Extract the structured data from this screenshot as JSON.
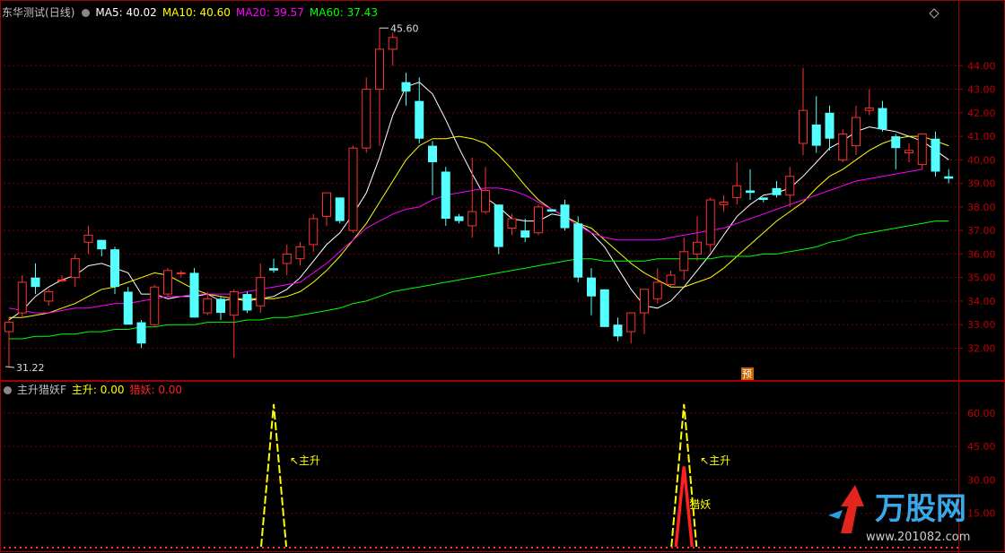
{
  "header": {
    "stock_name": "东华测试",
    "period": "(日线)",
    "ma": [
      {
        "label": "MA5:",
        "value": "40.02",
        "color": "#ffffff"
      },
      {
        "label": "MA10:",
        "value": "40.60",
        "color": "#ffff00"
      },
      {
        "label": "MA20:",
        "value": "39.57",
        "color": "#ff00ff"
      },
      {
        "label": "MA60:",
        "value": "37.43",
        "color": "#00ff00"
      }
    ]
  },
  "sub_header": {
    "indicator": "主升猎妖F",
    "items": [
      {
        "label": "主升:",
        "value": "0.00",
        "color": "#ffff00"
      },
      {
        "label": "猎妖:",
        "value": "0.00",
        "color": "#ff2020"
      }
    ]
  },
  "watermark": {
    "brand": "万股网",
    "url": "www.201082.com"
  },
  "chart_data": [
    {
      "type": "candlestick",
      "ylim": [
        30.8,
        45.8
      ],
      "yticks": [
        "32.00",
        "33.00",
        "34.00",
        "35.00",
        "36.00",
        "37.00",
        "38.00",
        "39.00",
        "40.00",
        "41.00",
        "42.00",
        "43.00",
        "44.00"
      ],
      "annotations": {
        "high": "45.60",
        "low": "31.22",
        "forecast_marker": "预"
      },
      "candles": [
        [
          32.7,
          33.3,
          31.2,
          33.1
        ],
        [
          33.5,
          35.1,
          33.3,
          34.8
        ],
        [
          35.0,
          35.6,
          34.3,
          34.6
        ],
        [
          34.0,
          34.5,
          33.8,
          34.4
        ],
        [
          34.9,
          35.1,
          34.8,
          34.9
        ],
        [
          35.0,
          36.0,
          34.6,
          35.8
        ],
        [
          36.5,
          37.2,
          36.0,
          36.8
        ],
        [
          36.6,
          36.6,
          35.9,
          36.2
        ],
        [
          36.2,
          36.3,
          34.3,
          34.6
        ],
        [
          34.4,
          34.6,
          33.0,
          33.0
        ],
        [
          33.1,
          33.2,
          32.0,
          32.2
        ],
        [
          33.0,
          34.7,
          32.9,
          34.6
        ],
        [
          34.3,
          35.4,
          34.2,
          35.3
        ],
        [
          35.2,
          35.3,
          35.0,
          35.2
        ],
        [
          35.2,
          35.4,
          33.9,
          33.3
        ],
        [
          33.5,
          34.4,
          33.4,
          34.1
        ],
        [
          34.1,
          34.2,
          33.2,
          33.5
        ],
        [
          33.4,
          34.5,
          31.6,
          34.4
        ],
        [
          34.3,
          34.4,
          33.5,
          33.6
        ],
        [
          33.8,
          35.6,
          33.5,
          35.0
        ],
        [
          35.4,
          35.8,
          35.2,
          35.3
        ],
        [
          35.6,
          36.4,
          35.1,
          36.0
        ],
        [
          35.8,
          36.5,
          35.5,
          36.3
        ],
        [
          36.4,
          37.7,
          36.1,
          37.5
        ],
        [
          37.6,
          38.6,
          37.2,
          38.6
        ],
        [
          38.4,
          38.4,
          37.3,
          37.4
        ],
        [
          37.0,
          40.6,
          36.9,
          40.5
        ],
        [
          40.5,
          43.5,
          40.3,
          43.0
        ],
        [
          43.0,
          45.6,
          40.6,
          44.7
        ],
        [
          44.7,
          45.4,
          44.0,
          45.2
        ],
        [
          43.3,
          43.7,
          42.3,
          42.9
        ],
        [
          42.5,
          43.5,
          40.7,
          40.9
        ],
        [
          40.6,
          40.8,
          38.5,
          39.9
        ],
        [
          39.5,
          39.7,
          37.2,
          37.5
        ],
        [
          37.6,
          37.7,
          37.3,
          37.4
        ],
        [
          37.2,
          40.1,
          36.7,
          37.8
        ],
        [
          37.8,
          39.7,
          37.7,
          38.7
        ],
        [
          38.1,
          38.1,
          36.0,
          36.3
        ],
        [
          37.1,
          37.7,
          36.8,
          37.5
        ],
        [
          37.0,
          37.5,
          36.5,
          36.7
        ],
        [
          36.9,
          38.1,
          36.8,
          38.0
        ],
        [
          37.9,
          37.9,
          37.8,
          37.8
        ],
        [
          38.1,
          38.3,
          37.0,
          37.1
        ],
        [
          37.3,
          37.6,
          34.8,
          35.0
        ],
        [
          35.0,
          35.4,
          33.4,
          34.2
        ],
        [
          34.5,
          34.5,
          32.9,
          32.9
        ],
        [
          33.0,
          33.3,
          32.3,
          32.5
        ],
        [
          32.7,
          33.5,
          32.2,
          33.5
        ],
        [
          33.5,
          34.5,
          32.6,
          34.5
        ],
        [
          34.1,
          35.4,
          33.9,
          34.8
        ],
        [
          34.7,
          35.3,
          34.6,
          35.1
        ],
        [
          35.3,
          36.7,
          34.9,
          36.1
        ],
        [
          36.0,
          37.6,
          35.7,
          36.5
        ],
        [
          36.4,
          38.4,
          36.1,
          38.3
        ],
        [
          38.1,
          38.5,
          37.8,
          38.2
        ],
        [
          38.4,
          39.9,
          38.1,
          38.9
        ],
        [
          38.7,
          39.6,
          38.3,
          38.6
        ],
        [
          38.4,
          38.4,
          38.2,
          38.3
        ],
        [
          38.8,
          39.1,
          38.4,
          38.5
        ],
        [
          38.5,
          39.7,
          38.0,
          39.3
        ],
        [
          40.7,
          43.9,
          40.2,
          42.1
        ],
        [
          41.5,
          42.7,
          40.3,
          40.6
        ],
        [
          42.0,
          42.3,
          40.4,
          40.9
        ],
        [
          40.0,
          41.3,
          39.9,
          41.1
        ],
        [
          40.6,
          42.3,
          40.2,
          41.8
        ],
        [
          42.1,
          43.0,
          41.9,
          42.2
        ],
        [
          42.2,
          42.5,
          41.2,
          41.3
        ],
        [
          41.0,
          41.1,
          39.6,
          40.5
        ],
        [
          40.3,
          40.7,
          39.9,
          40.4
        ],
        [
          39.8,
          41.1,
          39.6,
          41.1
        ],
        [
          40.9,
          41.2,
          39.3,
          39.5
        ],
        [
          39.3,
          39.6,
          39.0,
          39.2
        ]
      ],
      "series": [
        {
          "name": "MA5",
          "color": "#ffffff",
          "values": [
            33.2,
            33.6,
            34.2,
            34.6,
            34.9,
            35.1,
            35.5,
            35.6,
            35.4,
            35.2,
            34.3,
            34.3,
            34.1,
            34.2,
            34.2,
            34.3,
            34.0,
            34.1,
            34.0,
            34.1,
            34.2,
            34.5,
            35.0,
            35.7,
            36.4,
            36.9,
            37.7,
            38.6,
            40.1,
            41.9,
            43.1,
            43.3,
            42.8,
            41.7,
            40.5,
            39.4,
            38.4,
            38.0,
            37.5,
            37.4,
            37.4,
            37.7,
            37.6,
            37.3,
            36.9,
            36.3,
            35.4,
            34.5,
            33.8,
            33.7,
            34.0,
            34.6,
            35.3,
            36.0,
            36.8,
            37.6,
            38.1,
            38.5,
            38.6,
            38.8,
            39.3,
            39.9,
            40.5,
            40.8,
            41.2,
            41.4,
            41.3,
            41.2,
            41.0,
            40.8,
            40.4,
            40.0
          ]
        },
        {
          "name": "MA10",
          "color": "#ffff00",
          "values": [
            33.3,
            33.3,
            33.4,
            33.5,
            33.7,
            33.9,
            34.2,
            34.5,
            34.6,
            34.8,
            35.0,
            35.2,
            35.1,
            34.8,
            34.5,
            34.3,
            34.2,
            34.1,
            34.1,
            34.1,
            34.1,
            34.2,
            34.4,
            34.8,
            35.3,
            35.9,
            36.6,
            37.3,
            38.2,
            39.1,
            40.0,
            40.6,
            40.9,
            40.9,
            41.0,
            40.9,
            40.7,
            40.2,
            39.6,
            38.9,
            38.3,
            37.9,
            37.6,
            37.3,
            37.1,
            36.6,
            36.1,
            35.6,
            35.2,
            34.9,
            34.6,
            34.6,
            34.8,
            35.0,
            35.4,
            35.9,
            36.4,
            36.9,
            37.4,
            37.8,
            38.2,
            38.8,
            39.3,
            39.6,
            40.0,
            40.4,
            40.7,
            40.9,
            41.0,
            41.0,
            40.8,
            40.6
          ]
        },
        {
          "name": "MA20",
          "color": "#ff00ff",
          "values": [
            33.7,
            33.6,
            33.5,
            33.5,
            33.6,
            33.7,
            33.7,
            33.8,
            33.9,
            33.9,
            34.0,
            34.1,
            34.2,
            34.2,
            34.3,
            34.3,
            34.3,
            34.3,
            34.4,
            34.5,
            34.6,
            34.7,
            34.8,
            35.2,
            35.6,
            36.1,
            36.6,
            37.1,
            37.4,
            37.7,
            37.9,
            38.0,
            38.3,
            38.5,
            38.6,
            38.7,
            38.8,
            38.8,
            38.7,
            38.5,
            38.2,
            37.9,
            37.6,
            37.2,
            36.9,
            36.7,
            36.6,
            36.6,
            36.6,
            36.6,
            36.7,
            36.8,
            36.9,
            37.0,
            37.1,
            37.3,
            37.5,
            37.7,
            37.9,
            38.1,
            38.3,
            38.5,
            38.7,
            38.9,
            39.1,
            39.2,
            39.3,
            39.4,
            39.5,
            39.6
          ]
        },
        {
          "name": "MA60",
          "color": "#00ff00",
          "values": [
            32.4,
            32.4,
            32.5,
            32.5,
            32.6,
            32.6,
            32.7,
            32.7,
            32.8,
            32.8,
            32.9,
            32.9,
            33.0,
            33.0,
            33.0,
            33.1,
            33.1,
            33.1,
            33.2,
            33.2,
            33.3,
            33.3,
            33.4,
            33.5,
            33.6,
            33.7,
            33.9,
            34.0,
            34.2,
            34.4,
            34.5,
            34.6,
            34.7,
            34.8,
            34.9,
            35.0,
            35.1,
            35.2,
            35.3,
            35.4,
            35.5,
            35.6,
            35.7,
            35.8,
            35.8,
            35.7,
            35.7,
            35.7,
            35.7,
            35.8,
            35.8,
            35.8,
            35.8,
            35.8,
            35.9,
            35.9,
            35.9,
            36.0,
            36.0,
            36.1,
            36.2,
            36.3,
            36.5,
            36.6,
            36.8,
            36.9,
            37.0,
            37.1,
            37.2,
            37.3,
            37.4,
            37.4
          ]
        }
      ]
    },
    {
      "type": "line",
      "ylim": [
        0,
        70
      ],
      "yticks": [
        "15.00",
        "30.00",
        "45.00",
        "60.00"
      ],
      "series": [
        {
          "name": "主升",
          "color": "#ffff00",
          "spikes": [
            {
              "at": 20,
              "peak": 64
            },
            {
              "at": 51,
              "peak": 64
            }
          ]
        },
        {
          "name": "猎妖",
          "color": "#ff2020",
          "spikes": [
            {
              "at": 51,
              "peak": 36
            }
          ]
        }
      ],
      "annotations": [
        "主升",
        "主升",
        "猎妖"
      ]
    }
  ]
}
